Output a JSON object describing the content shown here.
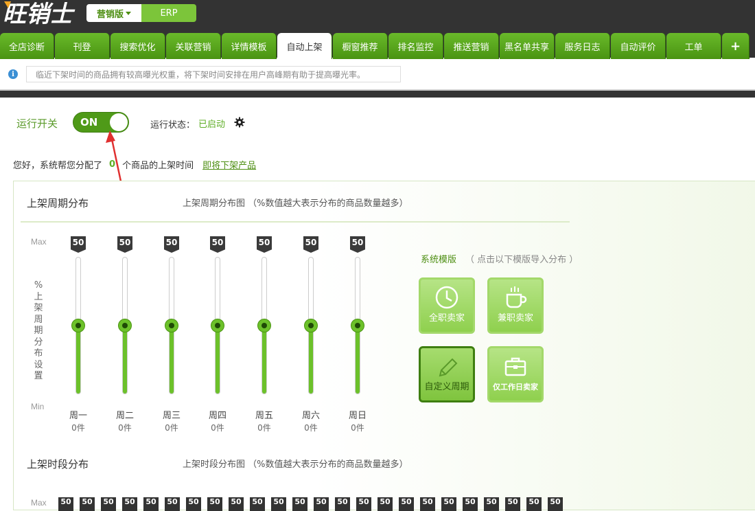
{
  "app": {
    "logo_text": "旺销士",
    "version_label": "营销版",
    "erp_label": "ERP"
  },
  "tabs": [
    {
      "label": "全店诊断"
    },
    {
      "label": "刊登"
    },
    {
      "label": "搜索优化"
    },
    {
      "label": "关联营销"
    },
    {
      "label": "详情模板"
    },
    {
      "label": "自动上架",
      "active": true
    },
    {
      "label": "橱窗推荐"
    },
    {
      "label": "排名监控"
    },
    {
      "label": "推送营销"
    },
    {
      "label": "黑名单共享"
    },
    {
      "label": "服务日志"
    },
    {
      "label": "自动评价"
    },
    {
      "label": "工单"
    },
    {
      "label": "+"
    }
  ],
  "info": {
    "text": "临近下架时间的商品拥有较高曝光权重，将下架时间安排在用户高峰期有助于提高曝光率。"
  },
  "run": {
    "switch_label": "运行开关",
    "toggle_text": "ON",
    "status_label": "运行状态：",
    "status_value": "已启动"
  },
  "greeting": {
    "prefix": "您好，系统帮您分配了",
    "count": "0",
    "suffix": "个商品的上架时间",
    "link": "即将下架产品"
  },
  "weekly": {
    "title": "上架周期分布",
    "subtitle": "上架周期分布图 （%数值越大表示分布的商品数量越多）",
    "axis_max": "Max",
    "axis_min": "Min",
    "vertical_label": "%上架周期分布设置",
    "sliders": [
      {
        "day": "周一",
        "value": "50",
        "count": "0件",
        "level": 0.5
      },
      {
        "day": "周二",
        "value": "50",
        "count": "0件",
        "level": 0.5
      },
      {
        "day": "周三",
        "value": "50",
        "count": "0件",
        "level": 0.5
      },
      {
        "day": "周四",
        "value": "50",
        "count": "0件",
        "level": 0.5
      },
      {
        "day": "周五",
        "value": "50",
        "count": "0件",
        "level": 0.5
      },
      {
        "day": "周六",
        "value": "50",
        "count": "0件",
        "level": 0.5
      },
      {
        "day": "周日",
        "value": "50",
        "count": "0件",
        "level": 0.5
      }
    ]
  },
  "templates": {
    "title": "系统模版",
    "hint": "（ 点击以下模版导入分布 ）",
    "items": [
      {
        "label": "全职卖家",
        "icon": "clock-icon"
      },
      {
        "label": "兼职卖家",
        "icon": "coffee-cup-icon"
      },
      {
        "label": "自定义周期",
        "icon": "pencil-icon",
        "selected": true
      },
      {
        "label": "仅工作日卖家",
        "icon": "briefcase-icon"
      }
    ]
  },
  "hourly": {
    "title": "上架时段分布",
    "subtitle": "上架时段分布图 （%数值越大表示分布的商品数量越多）",
    "axis_max": "Max",
    "tag_values": [
      "50",
      "50",
      "50",
      "50",
      "50",
      "50",
      "50",
      "50",
      "50",
      "50",
      "50",
      "50",
      "50",
      "50",
      "50",
      "50",
      "50",
      "50",
      "50",
      "50",
      "50",
      "50",
      "50",
      "50"
    ]
  },
  "colors": {
    "brand_green": "#5fae27",
    "dark_bar": "#333333",
    "slider_fill": "#6cc12a"
  }
}
